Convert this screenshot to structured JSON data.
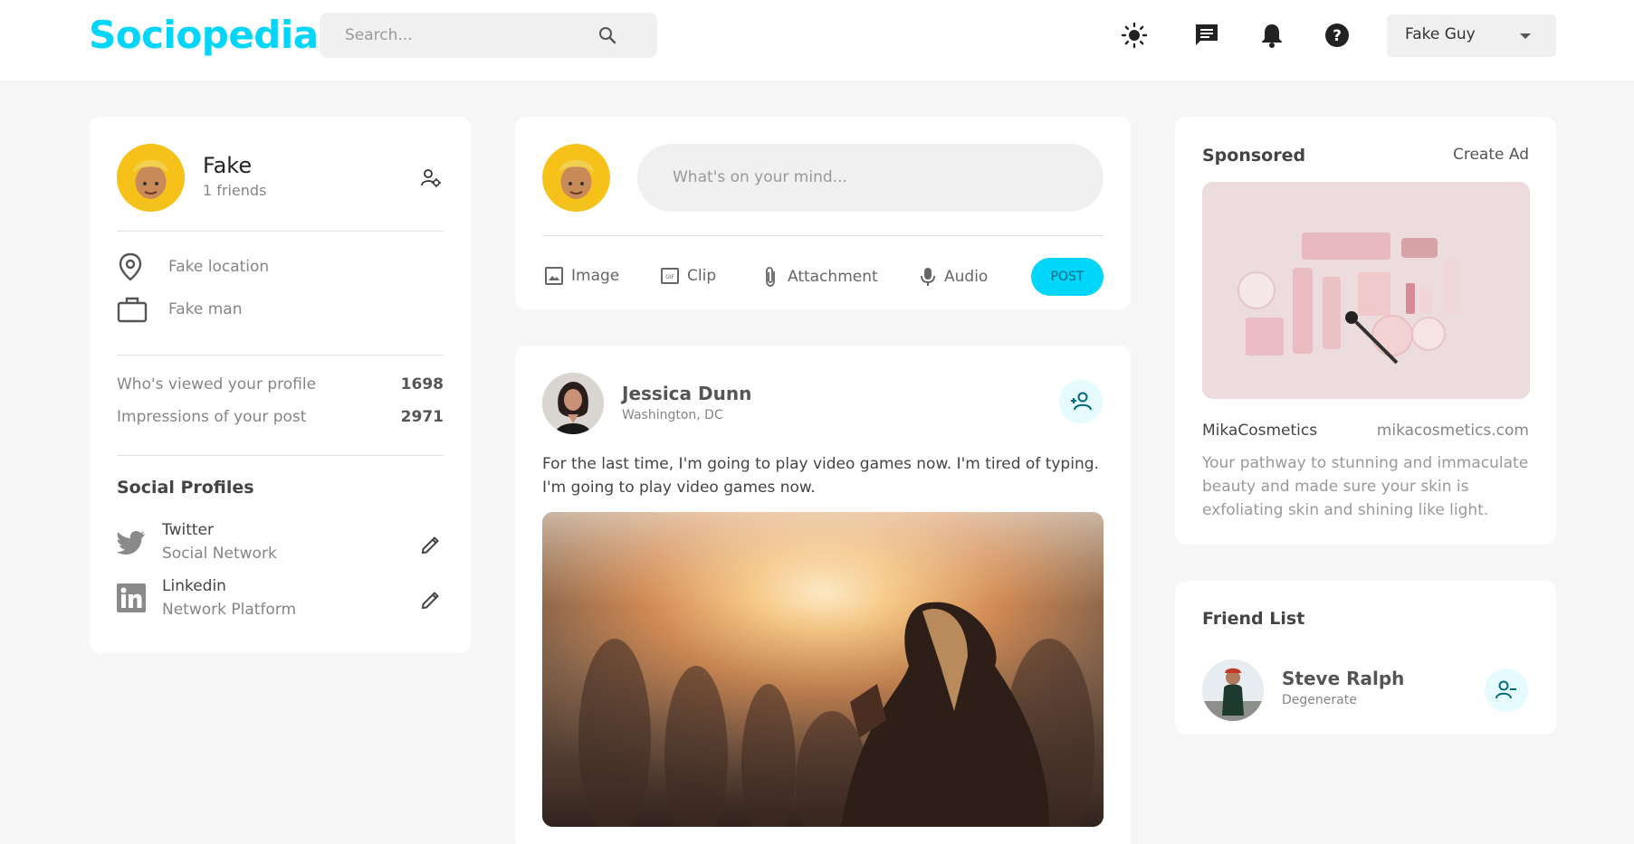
{
  "navbar": {
    "logo": "Sociopedia",
    "search_placeholder": "Search...",
    "icons": [
      "sun-icon",
      "message-icon",
      "bell-icon",
      "help-icon"
    ],
    "user_name": "Fake Guy"
  },
  "profile": {
    "name": "Fake",
    "friends": "1 friends",
    "location": "Fake location",
    "occupation": "Fake man",
    "viewed_label": "Who's viewed your profile",
    "viewed_count": "1698",
    "impressions_label": "Impressions of your post",
    "impressions_count": "2971",
    "social_title": "Social Profiles",
    "socials": [
      {
        "name": "Twitter",
        "type": "Social Network"
      },
      {
        "name": "Linkedin",
        "type": "Network Platform"
      }
    ]
  },
  "composer": {
    "placeholder": "What's on your mind...",
    "actions": [
      "Image",
      "Clip",
      "Attachment",
      "Audio"
    ],
    "post_label": "POST"
  },
  "post": {
    "author": "Jessica Dunn",
    "location": "Washington, DC",
    "text": "For the last time, I'm going to play video games now. I'm tired of typing. I'm going to play video games now."
  },
  "sponsored": {
    "title": "Sponsored",
    "create": "Create Ad",
    "brand": "MikaCosmetics",
    "site": "mikacosmetics.com",
    "description": "Your pathway to stunning and immaculate beauty and made sure your skin is exfoliating skin and shining like light."
  },
  "friends": {
    "title": "Friend List",
    "list": [
      {
        "name": "Steve Ralph",
        "subtitle": "Degenerate"
      }
    ]
  },
  "colors": {
    "primary": "#00d5fa",
    "background": "#f6f6f6",
    "card": "#ffffff"
  }
}
